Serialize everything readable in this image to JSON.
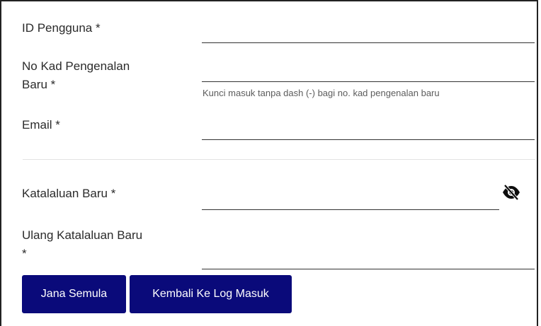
{
  "form": {
    "user_id_label": "ID Pengguna *",
    "ic_label_line1": "No Kad Pengenalan",
    "ic_label_line2": "Baru *",
    "ic_help": "Kunci masuk tanpa dash (-) bagi no. kad pengenalan baru",
    "email_label": "Email *",
    "new_password_label": "Katalaluan Baru *",
    "repeat_password_label_line1": "Ulang Katalaluan Baru",
    "repeat_password_label_line2": "*",
    "password_visibility_icon": "eye-slash-icon"
  },
  "actions": {
    "reset_label": "Jana Semula",
    "back_label": "Kembali Ke Log Masuk"
  },
  "colors": {
    "button_bg": "#0a0a7a",
    "button_text": "#ffffff",
    "field_border": "#333333"
  }
}
